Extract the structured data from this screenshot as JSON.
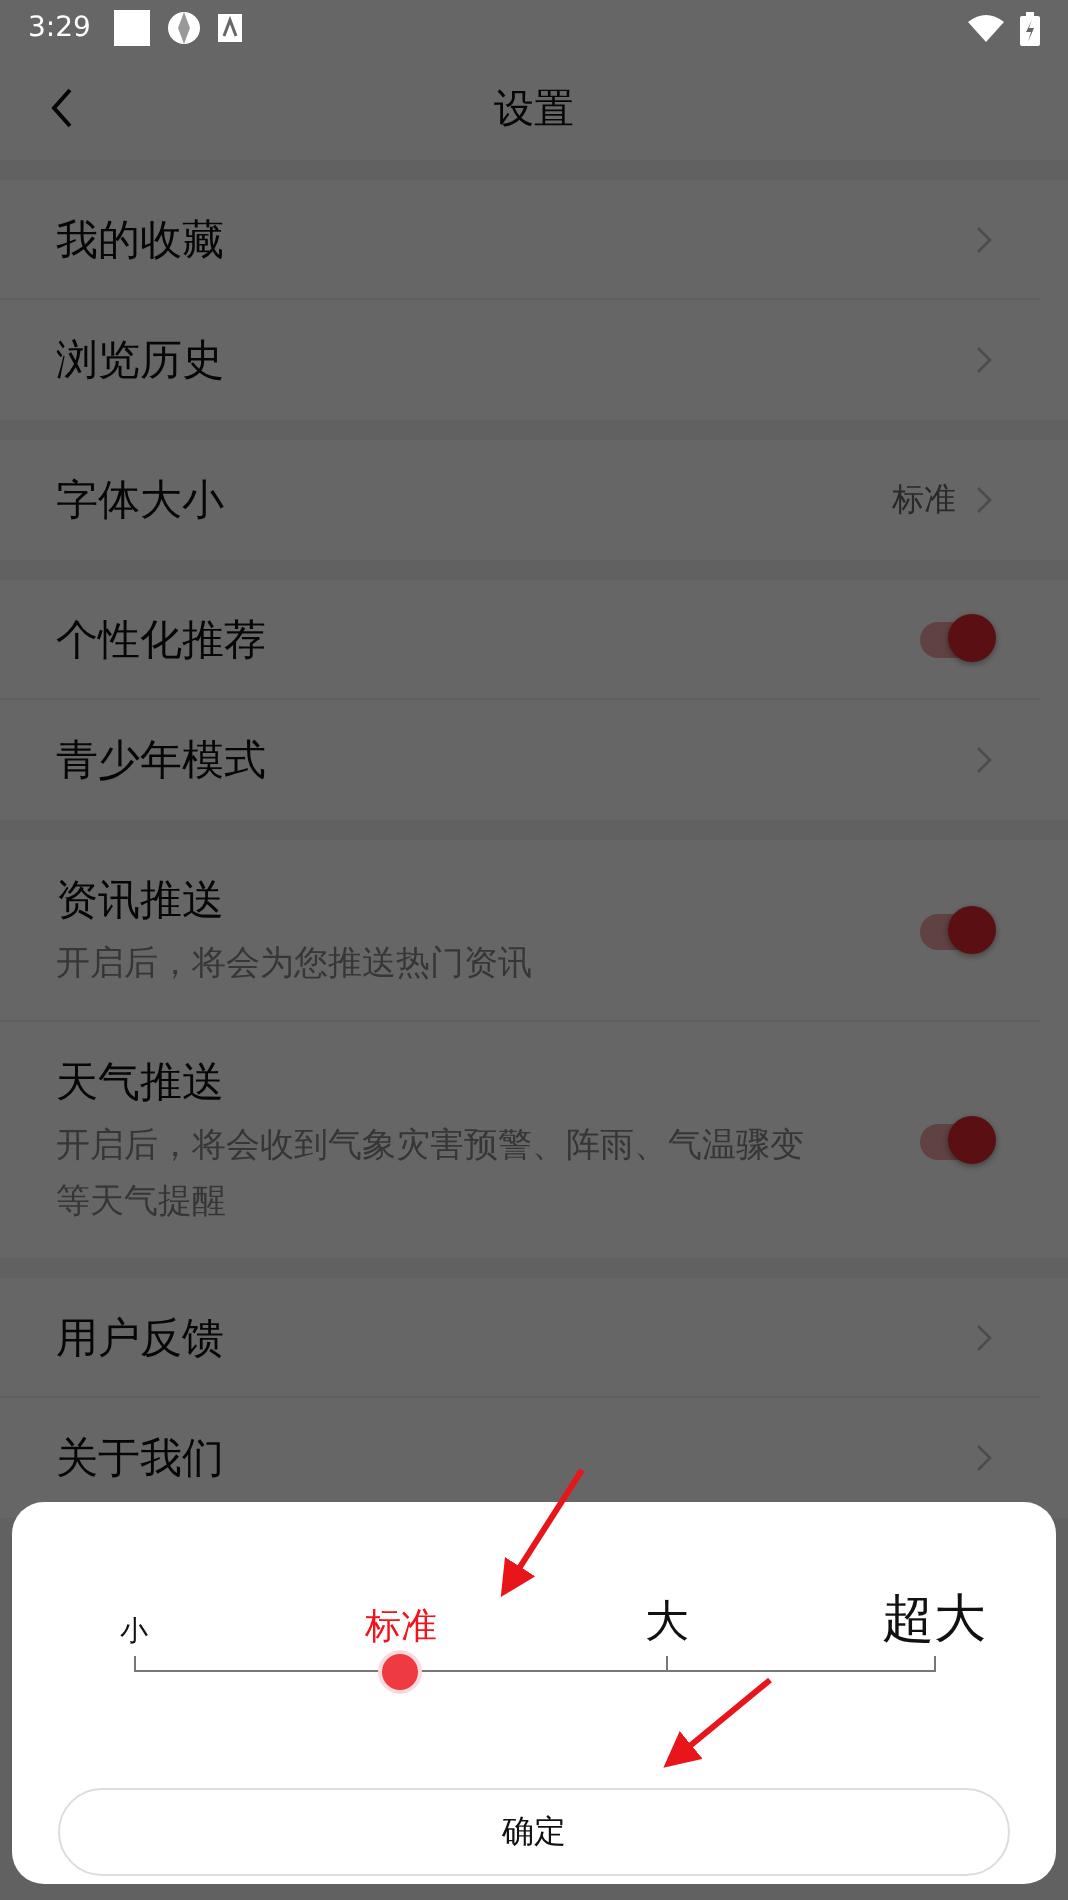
{
  "status_bar": {
    "time": "3:29"
  },
  "header": {
    "title": "设置"
  },
  "groups": [
    {
      "items": [
        {
          "kind": "link",
          "label": "我的收藏"
        },
        {
          "kind": "link",
          "label": "浏览历史"
        }
      ]
    },
    {
      "items": [
        {
          "kind": "value",
          "label": "字体大小",
          "value": "标准"
        }
      ]
    },
    {
      "items": [
        {
          "kind": "toggle",
          "label": "个性化推荐",
          "on": true
        },
        {
          "kind": "link",
          "label": "青少年模式"
        }
      ]
    },
    {
      "items": [
        {
          "kind": "toggle",
          "label": "资讯推送",
          "subtitle": "开启后，将会为您推送热门资讯",
          "on": true
        },
        {
          "kind": "toggle",
          "label": "天气推送",
          "subtitle": "开启后，将会收到气象灾害预警、阵雨、气温骤变等天气提醒",
          "on": true
        }
      ]
    },
    {
      "items": [
        {
          "kind": "link",
          "label": "用户反馈"
        },
        {
          "kind": "link",
          "label": "关于我们"
        }
      ]
    }
  ],
  "font_size_sheet": {
    "options": [
      {
        "label": "小",
        "selected": false
      },
      {
        "label": "标准",
        "selected": true
      },
      {
        "label": "大",
        "selected": false
      },
      {
        "label": "超大",
        "selected": false
      }
    ],
    "level": 0.333,
    "confirm_button": "确定"
  }
}
